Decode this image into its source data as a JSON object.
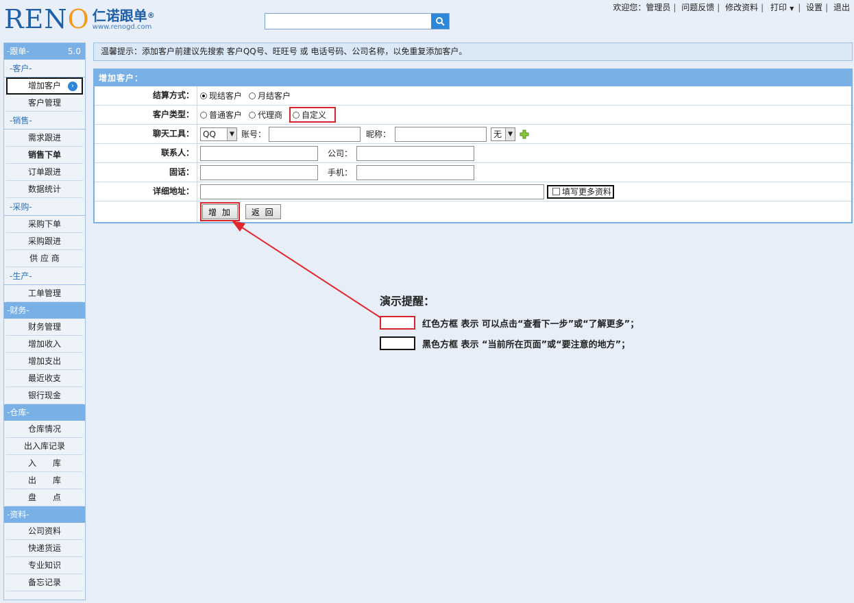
{
  "header": {
    "logo_text": "RENO",
    "logo_cn": "仁诺跟单",
    "logo_url": "www.renogd.com",
    "search_placeholder": "",
    "topnav": {
      "welcome": "欢迎您：管理员",
      "feedback": "问题反馈",
      "edit_profile": "修改资料",
      "print": "打印",
      "settings": "设置",
      "logout": "退出"
    }
  },
  "sidebar": {
    "title": "-跟单-",
    "version": "5.0",
    "sections": [
      {
        "type": "sub",
        "label": "-客户-"
      },
      {
        "type": "item",
        "label": "增加客户",
        "active": true
      },
      {
        "type": "item",
        "label": "客户管理"
      },
      {
        "type": "sub",
        "label": "-销售-"
      },
      {
        "type": "item",
        "label": "需求跟进"
      },
      {
        "type": "item",
        "label": "销售下单",
        "bold": true
      },
      {
        "type": "item",
        "label": "订单跟进"
      },
      {
        "type": "item",
        "label": "数据统计"
      },
      {
        "type": "sub",
        "label": "-采购-"
      },
      {
        "type": "item",
        "label": "采购下单"
      },
      {
        "type": "item",
        "label": "采购跟进"
      },
      {
        "type": "item",
        "label": "供 应 商"
      },
      {
        "type": "sub",
        "label": "-生产-"
      },
      {
        "type": "item",
        "label": "工单管理"
      },
      {
        "type": "group",
        "label": "-财务-"
      },
      {
        "type": "item",
        "label": "财务管理"
      },
      {
        "type": "item",
        "label": "增加收入"
      },
      {
        "type": "item",
        "label": "增加支出"
      },
      {
        "type": "item",
        "label": "最近收支"
      },
      {
        "type": "item",
        "label": "银行现金"
      },
      {
        "type": "group",
        "label": "-仓库-"
      },
      {
        "type": "item",
        "label": "仓库情况"
      },
      {
        "type": "item",
        "label": "出入库记录"
      },
      {
        "type": "item",
        "label": "入　　库"
      },
      {
        "type": "item",
        "label": "出　　库"
      },
      {
        "type": "item",
        "label": "盘　　点"
      },
      {
        "type": "group",
        "label": "-资料-"
      },
      {
        "type": "item",
        "label": "公司资料"
      },
      {
        "type": "item",
        "label": "快递货运"
      },
      {
        "type": "item",
        "label": "专业知识"
      },
      {
        "type": "item",
        "label": "备忘记录"
      }
    ]
  },
  "tip": "温馨提示：添加客户前建议先搜索 客户QQ号、旺旺号 或 电话号码、公司名称，以免重复添加客户。",
  "form": {
    "title": "增加客户：",
    "settlement": {
      "label": "结算方式：",
      "options": [
        "现结客户",
        "月结客户"
      ],
      "selected": 0
    },
    "customer_type": {
      "label": "客户类型：",
      "options": [
        "普通客户",
        "代理商",
        "自定义"
      ]
    },
    "chat": {
      "label": "聊天工具：",
      "tool": "QQ",
      "account_label": "账号：",
      "account_value": "",
      "nickname_label": "昵称：",
      "nickname_value": "",
      "extra": "无"
    },
    "contact": {
      "label": "联系人：",
      "value": "",
      "company_label": "公司：",
      "company_value": ""
    },
    "phone": {
      "label": "固话：",
      "value": "",
      "mobile_label": "手机：",
      "mobile_value": ""
    },
    "address": {
      "label": "详细地址：",
      "value": "",
      "more_label": "填写更多资料"
    },
    "add_button": "增 加",
    "back_button": "返 回"
  },
  "demo": {
    "title": "演示提醒：",
    "red_text": "红色方框 表示 可以点击“查看下一步”或“了解更多”；",
    "black_text": "黑色方框 表示 “当前所在页面”或“要注意的地方”；",
    "colors": {
      "red": "#d8222a",
      "black": "#111111"
    }
  }
}
